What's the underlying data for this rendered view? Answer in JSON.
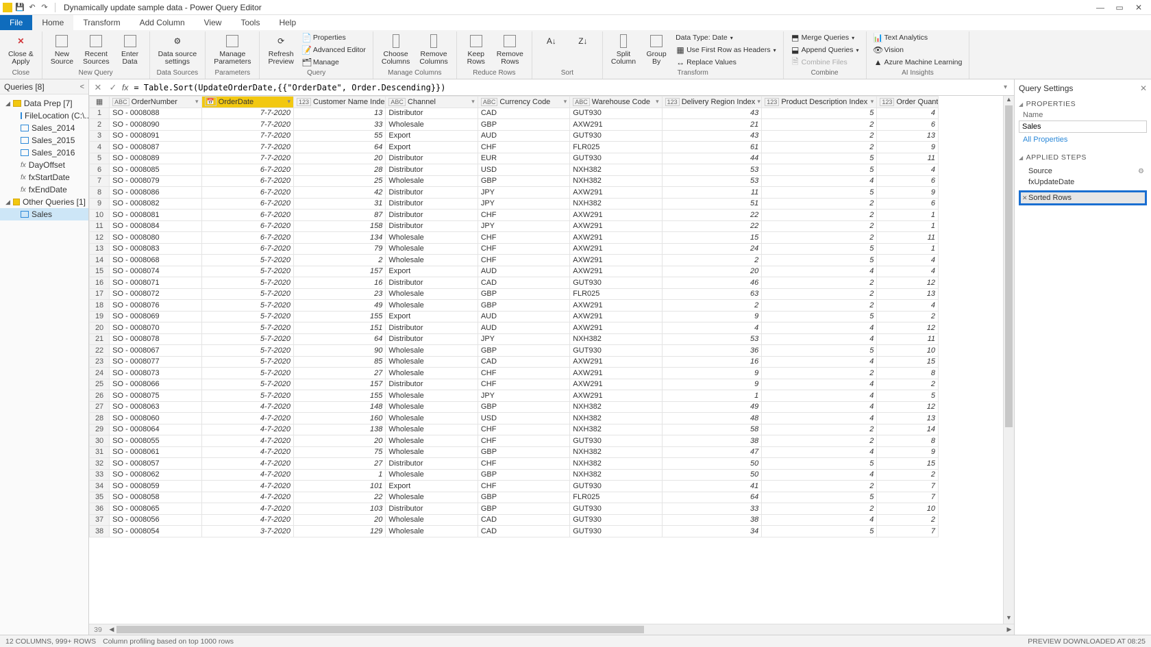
{
  "title": "Dynamically update sample data - Power Query Editor",
  "menu": {
    "file": "File",
    "home": "Home",
    "transform": "Transform",
    "addcol": "Add Column",
    "view": "View",
    "tools": "Tools",
    "help": "Help"
  },
  "ribbon": {
    "close_apply": "Close &\nApply",
    "new_source": "New\nSource",
    "recent_sources": "Recent\nSources",
    "enter_data": "Enter\nData",
    "ds_settings": "Data source\nsettings",
    "manage_params": "Manage\nParameters",
    "refresh": "Refresh\nPreview",
    "properties": "Properties",
    "adv_editor": "Advanced Editor",
    "manage": "Manage",
    "choose_cols": "Choose\nColumns",
    "remove_cols": "Remove\nColumns",
    "keep_rows": "Keep\nRows",
    "remove_rows": "Remove\nRows",
    "split_col": "Split\nColumn",
    "group_by": "Group\nBy",
    "datatype": "Data Type: Date",
    "first_row": "Use First Row as Headers",
    "replace": "Replace Values",
    "merge": "Merge Queries",
    "append": "Append Queries",
    "combine": "Combine Files",
    "text_an": "Text Analytics",
    "vision": "Vision",
    "azml": "Azure Machine Learning",
    "g_close": "Close",
    "g_newq": "New Query",
    "g_ds": "Data Sources",
    "g_params": "Parameters",
    "g_query": "Query",
    "g_mcols": "Manage Columns",
    "g_rrows": "Reduce Rows",
    "g_sort": "Sort",
    "g_transform": "Transform",
    "g_combine": "Combine",
    "g_ai": "AI Insights"
  },
  "queries": {
    "header": "Queries [8]",
    "folder1": "Data Prep [7]",
    "items1": [
      "FileLocation (C:\\...",
      "Sales_2014",
      "Sales_2015",
      "Sales_2016",
      "DayOffset",
      "fxStartDate",
      "fxEndDate"
    ],
    "folder2": "Other Queries [1]",
    "items2": [
      "Sales"
    ]
  },
  "formula": "= Table.Sort(UpdateOrderDate,{{\"OrderDate\", Order.Descending}})",
  "columns": [
    "OrderNumber",
    "OrderDate",
    "Customer Name Index",
    "Channel",
    "Currency Code",
    "Warehouse Code",
    "Delivery Region Index",
    "Product Description Index",
    "Order Quantity"
  ],
  "coltypes": [
    "ABC",
    "📅",
    "123",
    "ABC",
    "ABC",
    "ABC",
    "123",
    "123",
    "123"
  ],
  "rows": [
    [
      "SO - 0008088",
      "7-7-2020",
      "13",
      "Distributor",
      "CAD",
      "GUT930",
      "43",
      "5",
      "4"
    ],
    [
      "SO - 0008090",
      "7-7-2020",
      "33",
      "Wholesale",
      "GBP",
      "AXW291",
      "21",
      "2",
      "6"
    ],
    [
      "SO - 0008091",
      "7-7-2020",
      "55",
      "Export",
      "AUD",
      "GUT930",
      "43",
      "2",
      "13"
    ],
    [
      "SO - 0008087",
      "7-7-2020",
      "64",
      "Export",
      "CHF",
      "FLR025",
      "61",
      "2",
      "9"
    ],
    [
      "SO - 0008089",
      "7-7-2020",
      "20",
      "Distributor",
      "EUR",
      "GUT930",
      "44",
      "5",
      "11"
    ],
    [
      "SO - 0008085",
      "6-7-2020",
      "28",
      "Distributor",
      "USD",
      "NXH382",
      "53",
      "5",
      "4"
    ],
    [
      "SO - 0008079",
      "6-7-2020",
      "25",
      "Wholesale",
      "GBP",
      "NXH382",
      "53",
      "4",
      "6"
    ],
    [
      "SO - 0008086",
      "6-7-2020",
      "42",
      "Distributor",
      "JPY",
      "AXW291",
      "11",
      "5",
      "9"
    ],
    [
      "SO - 0008082",
      "6-7-2020",
      "31",
      "Distributor",
      "JPY",
      "NXH382",
      "51",
      "2",
      "6"
    ],
    [
      "SO - 0008081",
      "6-7-2020",
      "87",
      "Distributor",
      "CHF",
      "AXW291",
      "22",
      "2",
      "1"
    ],
    [
      "SO - 0008084",
      "6-7-2020",
      "158",
      "Distributor",
      "JPY",
      "AXW291",
      "22",
      "2",
      "1"
    ],
    [
      "SO - 0008080",
      "6-7-2020",
      "134",
      "Wholesale",
      "CHF",
      "AXW291",
      "15",
      "2",
      "11"
    ],
    [
      "SO - 0008083",
      "6-7-2020",
      "79",
      "Wholesale",
      "CHF",
      "AXW291",
      "24",
      "5",
      "1"
    ],
    [
      "SO - 0008068",
      "5-7-2020",
      "2",
      "Wholesale",
      "CHF",
      "AXW291",
      "2",
      "5",
      "4"
    ],
    [
      "SO - 0008074",
      "5-7-2020",
      "157",
      "Export",
      "AUD",
      "AXW291",
      "20",
      "4",
      "4"
    ],
    [
      "SO - 0008071",
      "5-7-2020",
      "16",
      "Distributor",
      "CAD",
      "GUT930",
      "46",
      "2",
      "12"
    ],
    [
      "SO - 0008072",
      "5-7-2020",
      "23",
      "Wholesale",
      "GBP",
      "FLR025",
      "63",
      "2",
      "13"
    ],
    [
      "SO - 0008076",
      "5-7-2020",
      "49",
      "Wholesale",
      "GBP",
      "AXW291",
      "2",
      "2",
      "4"
    ],
    [
      "SO - 0008069",
      "5-7-2020",
      "155",
      "Export",
      "AUD",
      "AXW291",
      "9",
      "5",
      "2"
    ],
    [
      "SO - 0008070",
      "5-7-2020",
      "151",
      "Distributor",
      "AUD",
      "AXW291",
      "4",
      "4",
      "12"
    ],
    [
      "SO - 0008078",
      "5-7-2020",
      "64",
      "Distributor",
      "JPY",
      "NXH382",
      "53",
      "4",
      "11"
    ],
    [
      "SO - 0008067",
      "5-7-2020",
      "90",
      "Wholesale",
      "GBP",
      "GUT930",
      "36",
      "5",
      "10"
    ],
    [
      "SO - 0008077",
      "5-7-2020",
      "85",
      "Wholesale",
      "CAD",
      "AXW291",
      "16",
      "4",
      "15"
    ],
    [
      "SO - 0008073",
      "5-7-2020",
      "27",
      "Wholesale",
      "CHF",
      "AXW291",
      "9",
      "2",
      "8"
    ],
    [
      "SO - 0008066",
      "5-7-2020",
      "157",
      "Distributor",
      "CHF",
      "AXW291",
      "9",
      "4",
      "2"
    ],
    [
      "SO - 0008075",
      "5-7-2020",
      "155",
      "Wholesale",
      "JPY",
      "AXW291",
      "1",
      "4",
      "5"
    ],
    [
      "SO - 0008063",
      "4-7-2020",
      "148",
      "Wholesale",
      "GBP",
      "NXH382",
      "49",
      "4",
      "12"
    ],
    [
      "SO - 0008060",
      "4-7-2020",
      "160",
      "Wholesale",
      "USD",
      "NXH382",
      "48",
      "4",
      "13"
    ],
    [
      "SO - 0008064",
      "4-7-2020",
      "138",
      "Wholesale",
      "CHF",
      "NXH382",
      "58",
      "2",
      "14"
    ],
    [
      "SO - 0008055",
      "4-7-2020",
      "20",
      "Wholesale",
      "CHF",
      "GUT930",
      "38",
      "2",
      "8"
    ],
    [
      "SO - 0008061",
      "4-7-2020",
      "75",
      "Wholesale",
      "GBP",
      "NXH382",
      "47",
      "4",
      "9"
    ],
    [
      "SO - 0008057",
      "4-7-2020",
      "27",
      "Distributor",
      "CHF",
      "NXH382",
      "50",
      "5",
      "15"
    ],
    [
      "SO - 0008062",
      "4-7-2020",
      "1",
      "Wholesale",
      "GBP",
      "NXH382",
      "50",
      "4",
      "2"
    ],
    [
      "SO - 0008059",
      "4-7-2020",
      "101",
      "Export",
      "CHF",
      "GUT930",
      "41",
      "2",
      "7"
    ],
    [
      "SO - 0008058",
      "4-7-2020",
      "22",
      "Wholesale",
      "GBP",
      "FLR025",
      "64",
      "5",
      "7"
    ],
    [
      "SO - 0008065",
      "4-7-2020",
      "103",
      "Distributor",
      "GBP",
      "GUT930",
      "33",
      "2",
      "10"
    ],
    [
      "SO - 0008056",
      "4-7-2020",
      "20",
      "Wholesale",
      "CAD",
      "GUT930",
      "38",
      "4",
      "2"
    ],
    [
      "SO - 0008054",
      "3-7-2020",
      "129",
      "Wholesale",
      "CAD",
      "GUT930",
      "34",
      "5",
      "7"
    ]
  ],
  "settings": {
    "title": "Query Settings",
    "props": "PROPERTIES",
    "namelbl": "Name",
    "name": "Sales",
    "allprops": "All Properties",
    "applied": "APPLIED STEPS",
    "steps": [
      "Source",
      "fxUpdateDate",
      "",
      "Sorted Rows"
    ]
  },
  "status": {
    "left": "12 COLUMNS, 999+ ROWS",
    "mid": "Column profiling based on top 1000 rows",
    "right": "PREVIEW DOWNLOADED AT 08:25"
  }
}
